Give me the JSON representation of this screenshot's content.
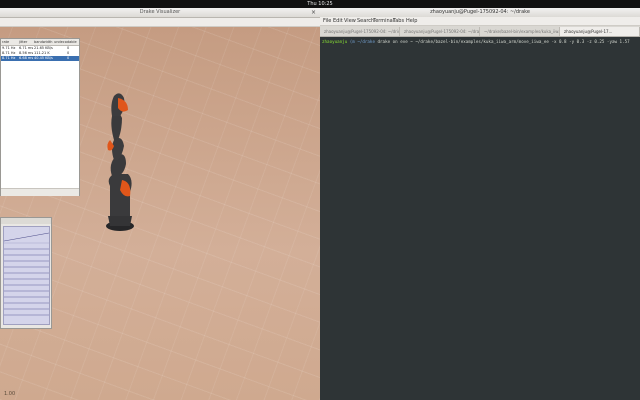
{
  "topbar": {
    "clock": "Thu 10:25"
  },
  "viewer": {
    "title": "Drake Visualizer",
    "close": "×",
    "fps": "1.00",
    "timing_table": {
      "headers": [
        "rate",
        "jitter",
        "bandwidth",
        "undecodable"
      ],
      "rows": [
        [
          "9.71 Hz",
          "6.71 ms",
          "21.65 KB/s",
          "0"
        ],
        [
          "8.71 Hz",
          "8.56 ms",
          "111.21 K",
          "0"
        ],
        [
          "8.71 Hz",
          "6.68 ms",
          "40.45 KB/s",
          "0"
        ]
      ]
    }
  },
  "terminal": {
    "title": "zhaoyuanju@Pugel-175092-04: ~/drake",
    "menus": [
      "File",
      "Edit",
      "View",
      "Search",
      "Terminal",
      "Tabs",
      "Help"
    ],
    "tabs": [
      "zhaoyuanju@Pugel-175092-04: ~/driv...",
      "zhaoyuanju@Pugel-175092-04: ~/drake/bazel-bin/examples/kuka_iiwa_arm/k...",
      "~/drake/bazel-bin/examples/kuka_iiw...",
      "zhaoyuanju@Pugel-17..."
    ],
    "prompt_user": "zhaoyuanju",
    "prompt_path": "(m ~/drake",
    "command": "drake on eve ~ ~/drake/bazel-bin/examples/kuka_iiwa_arm/move_iiwa_ee -x 0.8 -y 0.3 -z 0.25 -yaw 1.57"
  },
  "colors": {
    "ground": "#c9a188",
    "terminal_bg": "#2e3436",
    "robot_body": "#3a3a3c",
    "robot_accent": "#e0561a",
    "selection": "#3a6fb0"
  }
}
